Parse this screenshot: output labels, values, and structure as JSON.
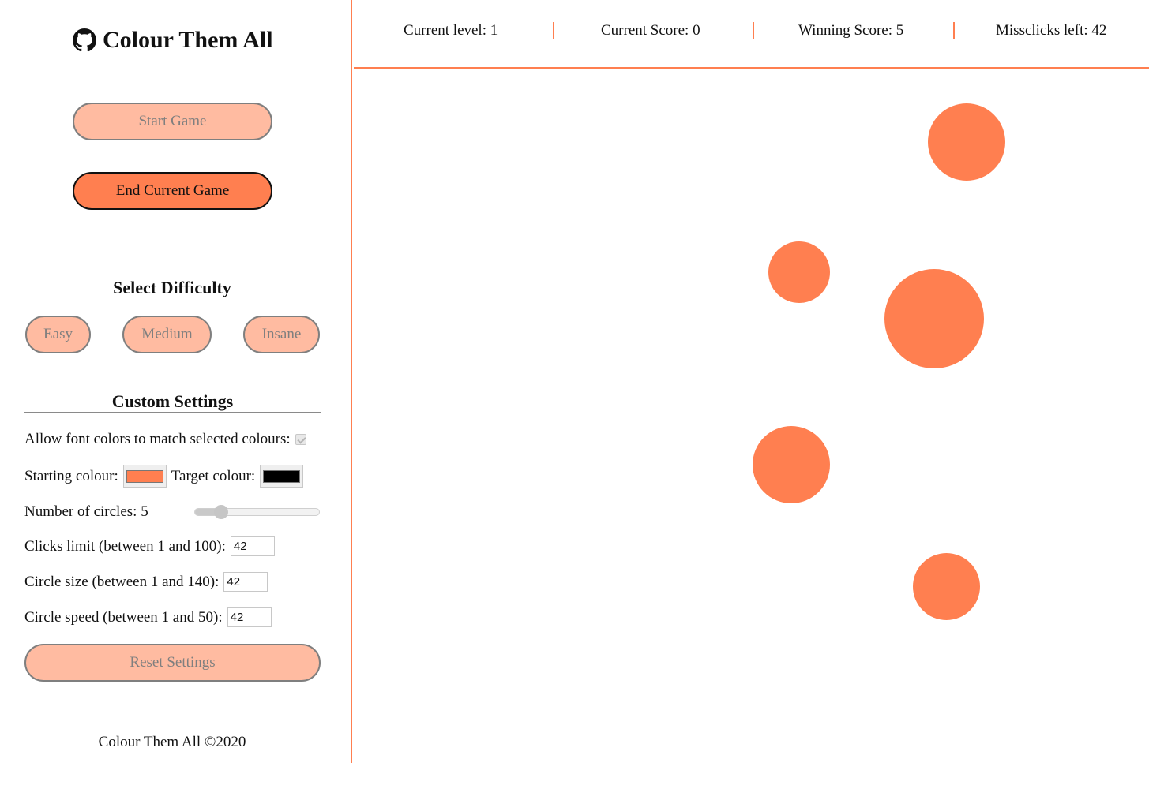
{
  "sidebar": {
    "title": "Colour Them All",
    "brand_icon": "github-icon",
    "start_label": "Start Game",
    "end_label": "End Current Game",
    "difficulty_title": "Select Difficulty",
    "difficulties": [
      "Easy",
      "Medium",
      "Insane"
    ],
    "custom_title": "Custom Settings",
    "font_colors_label": "Allow font colors to match selected colours:",
    "font_colors_checked": true,
    "starting_colour_label": "Starting colour:",
    "starting_colour": "#ff7f50",
    "target_colour_label": "Target colour:",
    "target_colour": "#000000",
    "circles_label": "Number of circles: 5",
    "circles_value": 5,
    "clicks_label": "Clicks limit (between 1 and 100):",
    "clicks_value": "42",
    "size_label": "Circle size (between 1 and 140):",
    "size_value": "42",
    "speed_label": "Circle speed (between 1 and 50):",
    "speed_value": "42",
    "reset_label": "Reset Settings",
    "footer": "Colour Them All ©2020"
  },
  "header": {
    "level": "Current level: 1",
    "score": "Current Score: 0",
    "winning": "Winning Score: 5",
    "missclicks": "Missclicks left: 42"
  },
  "colors": {
    "accent": "#ff7f50",
    "disabled_bg": "#ffbba1",
    "disabled_text": "#7f7f7f"
  }
}
